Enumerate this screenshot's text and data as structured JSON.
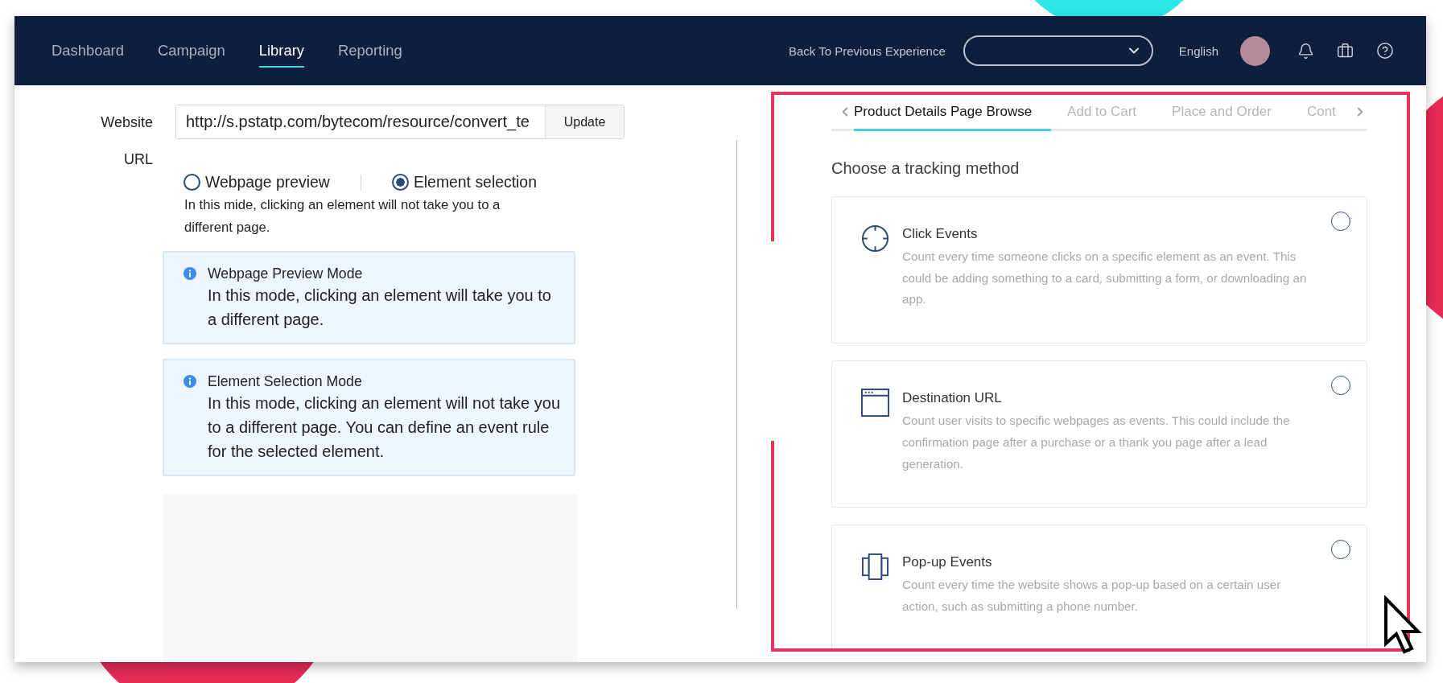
{
  "nav": {
    "items": [
      {
        "label": "Dashboard",
        "selected": false
      },
      {
        "label": "Campaign",
        "selected": false
      },
      {
        "label": "Library",
        "selected": true
      },
      {
        "label": "Reporting",
        "selected": false
      }
    ],
    "back_link": "Back To Previous Experience",
    "language": "English"
  },
  "form": {
    "label": "Website URL",
    "url": "http://s.pstatp.com/bytecom/resource/convert_te",
    "update_button": "Update",
    "modes": [
      {
        "label": "Webpage preview",
        "selected": false
      },
      {
        "label": "Element selection",
        "selected": true
      }
    ],
    "mode_note": "In this mide, clicking an element will not take you to a different page.",
    "info_boxes": [
      {
        "title": "Webpage Preview Mode",
        "body": "In this mode, clicking an element will take you to a different page."
      },
      {
        "title": "Element Selection Mode",
        "body": "In this mode, clicking an element will not take you to a different page. You can define an event rule for the selected element."
      }
    ]
  },
  "events": {
    "tabs": [
      {
        "label": "Product Details Page Browse",
        "selected": true
      },
      {
        "label": "Add to Cart",
        "selected": false
      },
      {
        "label": "Place and Order",
        "selected": false
      },
      {
        "label": "Cont",
        "selected": false
      }
    ],
    "heading": "Choose a tracking method",
    "methods": [
      {
        "kind": "click",
        "title": "Click Events",
        "description": "Count every time someone clicks on a specific element as an event. This could be adding something to a card, submitting a form, or downloading an app.",
        "selected": false
      },
      {
        "kind": "destination",
        "title": "Destination URL",
        "description": "Count user visits to specific webpages as events. This could include the confirmation page after a purchase or a thank you page after a lead generation.",
        "selected": false
      },
      {
        "kind": "popup",
        "title": "Pop-up Events",
        "description": "Count every time the website shows a pop-up based on a certain user action, such as submitting a phone number.",
        "selected": false
      }
    ]
  }
}
